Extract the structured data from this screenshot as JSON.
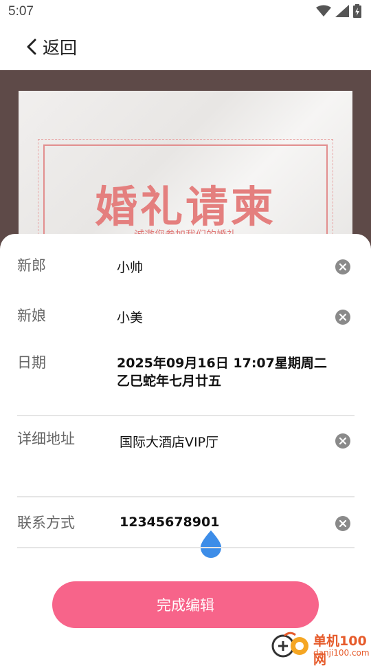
{
  "status_bar": {
    "time": "5:07",
    "icons": [
      "wifi-icon",
      "signal-icon",
      "battery-icon"
    ]
  },
  "nav": {
    "back_label": "返回"
  },
  "card": {
    "title": "婚礼请柬",
    "subtitle": "诚邀您参加我们的婚礼"
  },
  "form": {
    "groom": {
      "label": "新郎",
      "value": "小帅"
    },
    "bride": {
      "label": "新娘",
      "value": "小美"
    },
    "date": {
      "label": "日期",
      "value_line1": "2025年09月16日 17:07星期周二",
      "value_line2": "乙巳蛇年七月廿五"
    },
    "address": {
      "label": "详细地址",
      "value": "国际大酒店VIP厅"
    },
    "contact": {
      "label": "联系方式",
      "value": "12345678901"
    }
  },
  "actions": {
    "done_label": "完成编辑"
  },
  "watermark": {
    "name": "单机100网",
    "url": "danji100.com"
  },
  "colors": {
    "accent": "#f7648a",
    "card_bg": "#5e4a48",
    "title_red": "#e47f7e",
    "cursor_blue": "#3d8de8"
  }
}
